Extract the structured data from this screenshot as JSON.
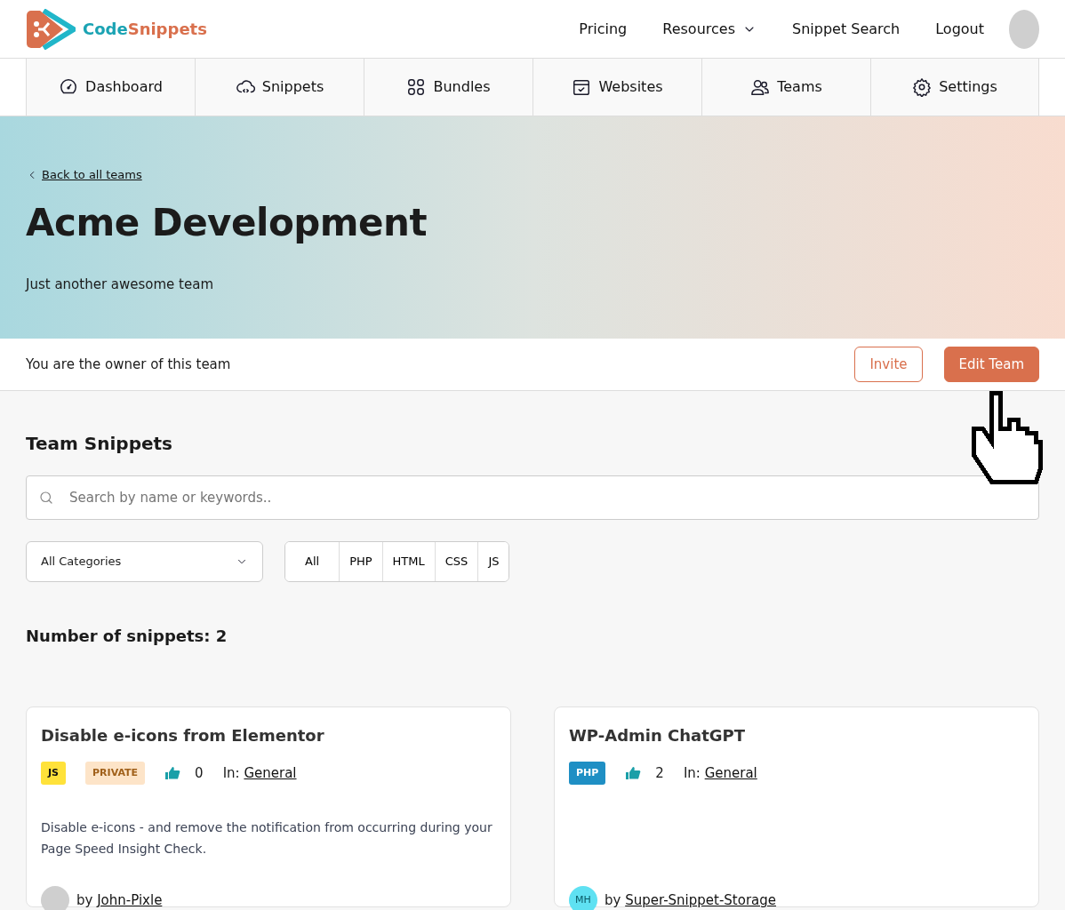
{
  "brand": {
    "part_1": "Code",
    "part_2": "Snippets"
  },
  "top_menu": [
    {
      "label": "Pricing",
      "dropdown": false
    },
    {
      "label": "Resources",
      "dropdown": true
    },
    {
      "label": "Snippet Search",
      "dropdown": false
    },
    {
      "label": "Logout",
      "dropdown": false
    }
  ],
  "nav_tabs": [
    {
      "label": "Dashboard"
    },
    {
      "label": "Snippets"
    },
    {
      "label": "Bundles"
    },
    {
      "label": "Websites"
    },
    {
      "label": "Teams"
    },
    {
      "label": "Settings"
    }
  ],
  "hero": {
    "back_link": "Back to all teams",
    "title": "Acme Development",
    "subtitle": "Just another awesome team"
  },
  "owner_bar": {
    "text": "You are the owner of this team",
    "buttons": [
      {
        "label": "Invite",
        "kind": "outline"
      },
      {
        "label": "Edit Team",
        "kind": "solid"
      }
    ]
  },
  "section_title": "Team Snippets",
  "search": {
    "placeholder": "Search by name or keywords.."
  },
  "category_select": {
    "value": "All Categories"
  },
  "filters": [
    "All",
    "PHP",
    "HTML",
    "CSS",
    "JS"
  ],
  "count": "Number of snippets: 2",
  "snippets": [
    {
      "title": "Disable e-icons from Elementor",
      "tags": [
        {
          "label": "JS",
          "color": "#ffe23a"
        },
        {
          "label": "PRIVATE",
          "color": "#fde4c8"
        }
      ],
      "likes": "0",
      "category_prefix": "In:",
      "category": "General",
      "description": "Disable e-icons - and remove the notification from occurring during your Page Speed Insight Check.",
      "author_prefix": "by",
      "author": "John-Pixle",
      "avatar": {
        "kind": "photo"
      }
    },
    {
      "title": "WP-Admin ChatGPT",
      "tags": [
        {
          "label": "PHP",
          "color": "#1f8fc4"
        }
      ],
      "likes": "2",
      "category_prefix": "In:",
      "category": "General",
      "author_prefix": "by",
      "author": "Super-Snippet-Storage",
      "avatar": {
        "kind": "initials",
        "initials": "MH"
      }
    }
  ]
}
